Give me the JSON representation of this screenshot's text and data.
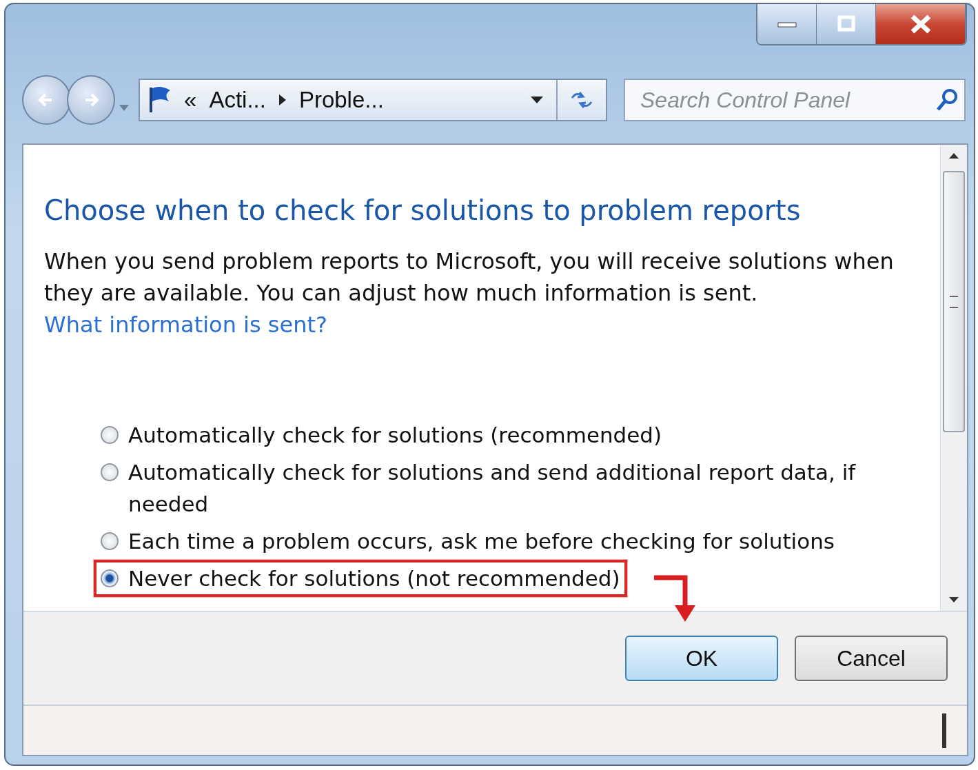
{
  "address_bar": {
    "overflow": "«",
    "segments": [
      "Acti...",
      "Proble..."
    ]
  },
  "search": {
    "placeholder": "Search Control Panel"
  },
  "heading": "Choose when to check for solutions to problem reports",
  "description": "When you send problem reports to Microsoft, you will receive solutions when they are available. You can adjust how much information is sent.",
  "link": "What information is sent?",
  "options": [
    {
      "label": "Automatically check for solutions (recommended)",
      "selected": false,
      "annotated": false
    },
    {
      "label": "Automatically check for solutions and send additional report data, if needed",
      "selected": false,
      "annotated": false
    },
    {
      "label": "Each time a problem occurs, ask me before checking for solutions",
      "selected": false,
      "annotated": false
    },
    {
      "label": "Never check for solutions (not recommended)",
      "selected": true,
      "annotated": true
    }
  ],
  "buttons": [
    {
      "label": "OK",
      "default": true
    },
    {
      "label": "Cancel",
      "default": false
    }
  ]
}
